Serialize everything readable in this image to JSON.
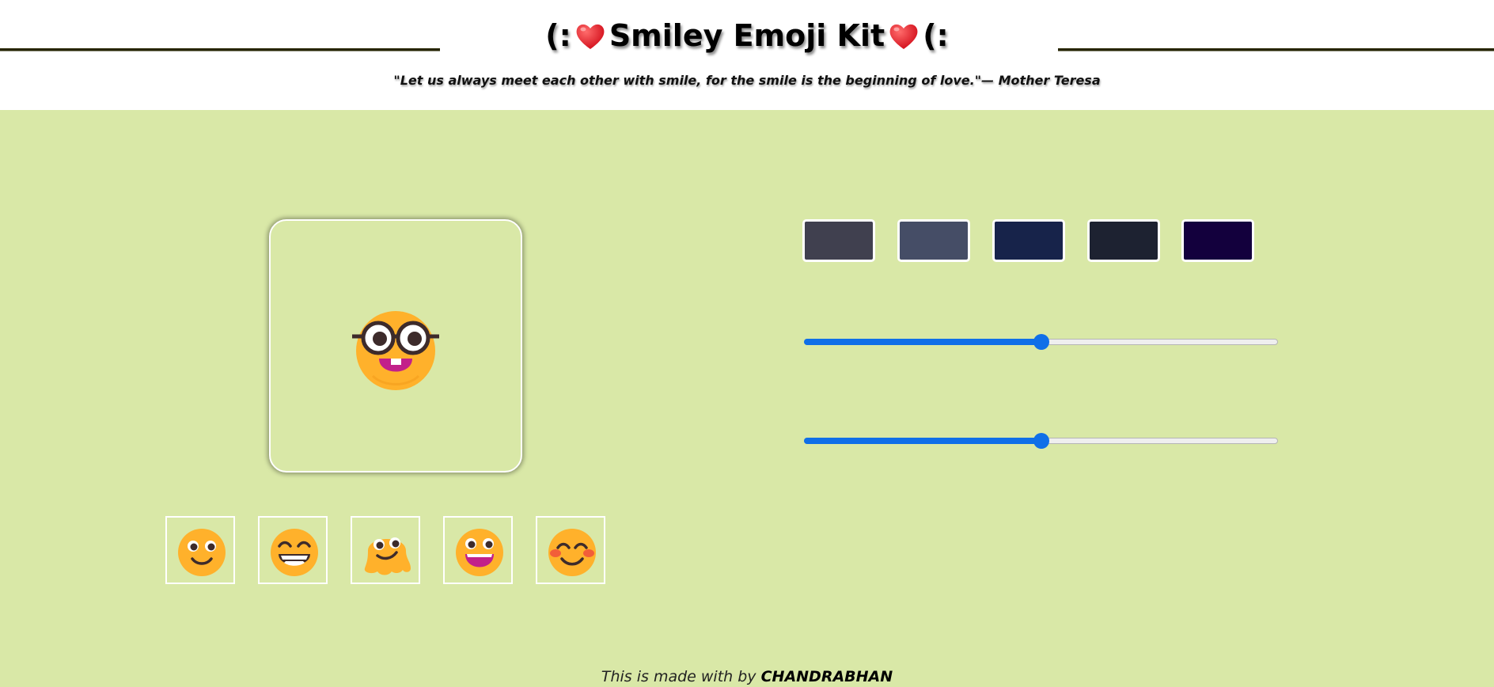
{
  "header": {
    "title_prefix": "(:",
    "title_text": "Smiley Emoji Kit",
    "title_suffix": "(:",
    "quote": "\"Let us always meet each other with smile, for the smile is the beginning of love.\"— Mother Teresa"
  },
  "preview": {
    "emoji": "nerd-face-icon"
  },
  "thumbnails": [
    {
      "name": "slightly-smiling-face-icon"
    },
    {
      "name": "grinning-squinting-face-icon"
    },
    {
      "name": "melting-face-icon"
    },
    {
      "name": "grinning-face-big-eyes-icon"
    },
    {
      "name": "smiling-face-blush-icon"
    }
  ],
  "swatches": [
    {
      "color": "#40404f"
    },
    {
      "color": "#454d66"
    },
    {
      "color": "#17234a"
    },
    {
      "color": "#1d2231"
    },
    {
      "color": "#13003d"
    }
  ],
  "sliders": [
    {
      "value_percent": 50
    },
    {
      "value_percent": 50
    }
  ],
  "footer": {
    "made_with": "This is made with by",
    "author": "CHANDRABHAN"
  },
  "colors": {
    "background": "#d9e8a7",
    "emoji_yellow": "#ffb12b",
    "slider_accent": "#0f6fe8"
  }
}
